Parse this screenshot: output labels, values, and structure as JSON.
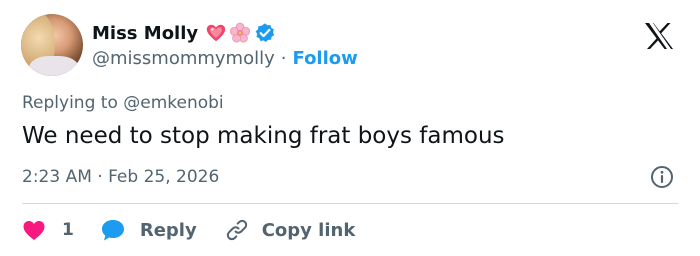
{
  "author": {
    "name": "Miss Molly",
    "handle": "@missmommymolly",
    "separator": "·",
    "follow_label": "Follow"
  },
  "reply_context": {
    "prefix": "Replying to",
    "mention": "@emkenobi"
  },
  "tweet": {
    "text": "We need to stop making frat boys famous",
    "timestamp": "2:23 AM · Feb 25, 2026"
  },
  "actions": {
    "like_count": "1",
    "reply_label": "Reply",
    "copy_label": "Copy link"
  },
  "colors": {
    "accent": "#1d9bf0",
    "like": "#f91880",
    "secondary_text": "#536471",
    "divider": "#cfd9de"
  },
  "icons": [
    "sparkling-heart-icon",
    "cherry-blossom-icon",
    "verified-badge-icon",
    "x-logo-icon",
    "info-icon",
    "heart-icon",
    "reply-bubble-icon",
    "link-icon"
  ]
}
